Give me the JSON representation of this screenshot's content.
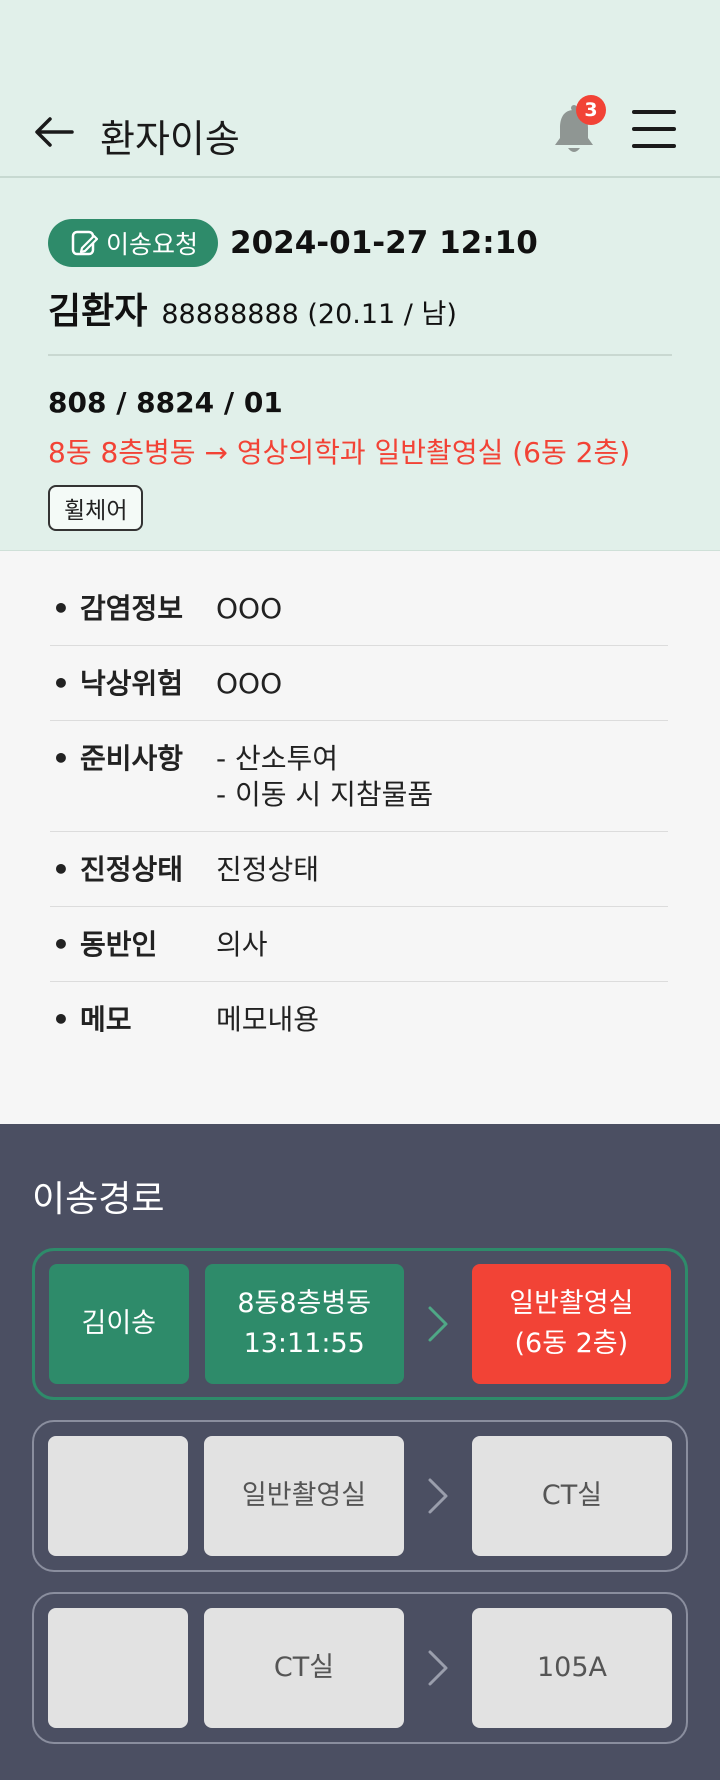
{
  "header": {
    "title": "환자이송",
    "notification_count": "3"
  },
  "patient": {
    "status_label": "이송요청",
    "datetime": "2024-01-27 12:10",
    "name": "김환자",
    "info": "88888888 (20.11 / 남)",
    "location_code": "808 / 8824 / 01",
    "route": "8동 8층병동 → 영상의학과 일반촬영실 (6동 2층)",
    "transport_mode": "휠체어"
  },
  "details": [
    {
      "label": "감염정보",
      "value": "OOO"
    },
    {
      "label": "낙상위험",
      "value": "OOO"
    },
    {
      "label": "준비사항",
      "value": "- 산소투여\n- 이동 시 지참물품"
    },
    {
      "label": "진정상태",
      "value": "진정상태"
    },
    {
      "label": "동반인",
      "value": "의사"
    },
    {
      "label": "메모",
      "value": "메모내용"
    }
  ],
  "transfer_path": {
    "title": "이송경로",
    "routes": [
      {
        "staff": "김이송",
        "from": "8동8층병동\n13:11:55",
        "to": "일반촬영실\n(6동 2층)",
        "active": true
      },
      {
        "staff": "",
        "from": "일반촬영실",
        "to": "CT실",
        "active": false
      },
      {
        "staff": "",
        "from": "CT실",
        "to": "105A",
        "active": false
      }
    ]
  },
  "colors": {
    "accent_green": "#2e8b6a",
    "alert_red": "#f24336",
    "header_bg": "#e1f0ea",
    "path_bg": "#4b4f62"
  }
}
